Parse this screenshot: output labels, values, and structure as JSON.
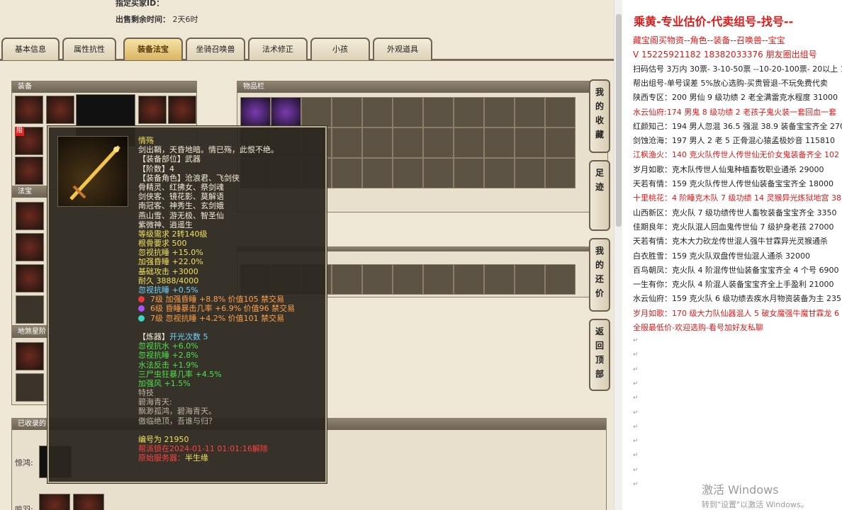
{
  "header": {
    "seller_label": "指定买家ID：",
    "time_label": "出售剩余时间：",
    "time_value": "2天6时"
  },
  "tabs": [
    "基本信息",
    "属性抗性",
    "装备法宝",
    "坐骑召唤兽",
    "法术修正",
    "小孩",
    "外观道具"
  ],
  "active_tab": "装备法宝",
  "panels": {
    "equip": "装备",
    "fabao": "法宝",
    "dishu": "地煞星阶",
    "inventory": "物品栏",
    "collected": "已收录的",
    "jinghong": "惊鸿:",
    "mingyu": "鸣羽:"
  },
  "limited_badge": "限",
  "tooltip": {
    "name": "情殇",
    "desc": "剑出鞘，天昏地暗。情已殇，此恨不绝。",
    "slot": "【装备部位】武器",
    "tier": "【阶数】4",
    "roles_title": "【装备角色】沧浪君、飞剑侠",
    "roles": [
      "骨精灵、红拂女、祭剑魂",
      "剑侠客、镜花影、莫解语",
      "南冠客、神秀生、玄剑娥",
      "燕山雪、游无极、智圣仙",
      "紫微神、逍遥生"
    ],
    "level_req": "等级需求 2转140级",
    "bone_req": "根骨要求 500",
    "stats": [
      "忽视抗睡 +15.0%",
      "加强昏睡 +22.0%",
      "基础攻击 +3000"
    ],
    "durability": "耐久 3888/4000",
    "extra_stat": "忽视抗睡 +0.5%",
    "gems": [
      {
        "icon": "gem-red-icon",
        "color": "#e83a3a",
        "text": "7级 加强昏睡 +8.8% 价值105 禁交易"
      },
      {
        "icon": "gem-purple-icon",
        "color": "#b050ff",
        "text": "6级 昏睡暴击几率 +6.9% 价值96 禁交易"
      },
      {
        "icon": "gem-cyan-icon",
        "color": "#3ad6c0",
        "text": "7级 忽视抗睡 +4.2% 价值101 禁交易"
      }
    ],
    "refine_title": "【炼器】",
    "refine_open": "开光次数 5",
    "refine_stats": [
      "忽视抗水 +6.0%",
      "忽视抗睡 +2.8%",
      "水法反击 +1.9%",
      "三尸虫狂暴几率 +4.5%",
      "加强风 +1.5%"
    ],
    "skill_label": "特技",
    "skill_name": "碧海青天:",
    "skill_desc": [
      "飘渺孤鸿，碧海青天。",
      "傲临绝顶，吾谁与归？"
    ],
    "serial": "编号为 21950",
    "lock": "帮派锁在2024-01-11 01:01:16解除",
    "origin_label": "原始服务器：",
    "origin_value": "半生缘"
  },
  "side_buttons": [
    "我的收藏",
    "足迹",
    "我的还价",
    "返回顶部"
  ],
  "right": {
    "title": "乘黄-专业估价-代卖组号-找号--",
    "lines": [
      {
        "text": "藏宝阁买物资--角色--装备--召唤兽--宝宝",
        "red": true
      },
      {
        "text": "V 15225921182 18382033376 朋友圈出组号",
        "red": true
      },
      {
        "text": "扫码估号 3万内 30票- 3-10-50票  --10-20-100票- 20以上 1",
        "red": false
      },
      {
        "text": "帮出组号-单号误差 5%放心选购-买贵管退-不玩免费代卖",
        "red": false
      },
      {
        "text": "陕西专区：200 男仙 9 级功绩 2 老全满雷克水程度 31000",
        "red": false
      },
      {
        "text": "水云仙府:174 男鬼 8 级功绩 2 老孩子鬼火装一套回血一套",
        "red": true
      },
      {
        "text": "红颜知己：194 男人忽混 36.5 强混 38.9 装备宝宝齐全 2700",
        "red": false
      },
      {
        "text": "剑蚀沧海：197 男人 2 老 5 正骨混心猿孟极妙音 115810",
        "red": false
      },
      {
        "text": "江枫渔火：140 克火队传世人传世仙无价女鬼装备齐全 102",
        "red": true
      },
      {
        "text": "岁月如歌：克木队传世人仙鬼种植畜牧职业通杀 29000",
        "red": false
      },
      {
        "text": "天若有情：159 克火队传世人传世仙装备宝宝齐全 18000",
        "red": false
      },
      {
        "text": "十里桃花：4 阶睡克木队 7 级功绩 14 灵猴异光炼狱地宫 38",
        "red": true
      },
      {
        "text": "山西新区：克火队 7 级功绩传世人畜牧装备宝宝齐全 3350",
        "red": false
      },
      {
        "text": "佳期良年：克火队混人回血鬼传世仙 7 级护身老孩 27000",
        "red": false
      },
      {
        "text": "天若有情：克木大力砍龙传世混人强牛甘霖异光灵猴通杀",
        "red": false
      },
      {
        "text": "白衣胜雪：159 克火队双盘传世仙混人通杀 32000",
        "red": false
      },
      {
        "text": "百鸟朝凤：克火队 4 阶混传世仙装备宝宝齐全 4 个号 6900",
        "red": false
      },
      {
        "text": "一生有你：克火队 4 阶混人装备宝宝齐全上手盈利 21000",
        "red": false
      },
      {
        "text": "水云仙府：159 克火队 6 级功绩去疾水月物资装备为主 235",
        "red": false
      },
      {
        "text": "岁月如歌：170 级大力队仙器混人 5 破女魔强牛魔甘霖龙 6",
        "red": true
      },
      {
        "text": "全服最低价-欢迎选购-看号加好友私聊",
        "red": true
      }
    ]
  },
  "watermark": {
    "line1": "激活 Windows",
    "line2": "转到\"设置\"以激活 Windows。"
  }
}
